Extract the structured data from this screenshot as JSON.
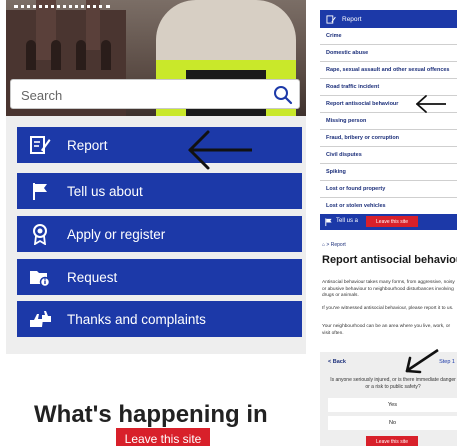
{
  "left": {
    "search": {
      "placeholder": "Search"
    },
    "buttons": [
      {
        "label": "Report",
        "icon": "report-icon"
      },
      {
        "label": "Tell us about",
        "icon": "flag-icon"
      },
      {
        "label": "Apply or register",
        "icon": "award-icon"
      },
      {
        "label": "Request",
        "icon": "folder-info-icon"
      },
      {
        "label": "Thanks and complaints",
        "icon": "thumbs-icon"
      }
    ],
    "headline": "What's happening in",
    "leave_label": "Leave this site"
  },
  "right": {
    "header_label": "Report",
    "items": [
      "Crime",
      "Domestic abuse",
      "Rape, sexual assault and other sexual offences",
      "Road traffic incident",
      "Report antisocial behaviour",
      "Missing person",
      "Fraud, bribery or corruption",
      "Civil disputes",
      "Spiking",
      "Lost or found property",
      "Lost or stolen vehicles"
    ],
    "bottom_button_label": "Tell us a",
    "leave_label": "Leave this site",
    "breadcrumb": "Report",
    "title": "Report antisocial behaviou",
    "paragraphs": [
      "Antisocial behaviour takes many forms, from aggressive, noisy or abusive behaviour to neighbourhood disturbances involving drugs or animals.",
      "If you've witnessed antisocial behaviour, please report it to us.",
      "Your neighbourhood can be an area where you live, work, or visit often."
    ],
    "form": {
      "back_label": "Back",
      "step_label": "Step 1",
      "question": "Is anyone seriously injured, or is there immediate danger or a risk to public safety?",
      "options": [
        "Yes",
        "No"
      ]
    }
  },
  "colors": {
    "brand_blue": "#1c39a8",
    "leave_red": "#d8202a",
    "panel_grey": "#eeeeee"
  }
}
